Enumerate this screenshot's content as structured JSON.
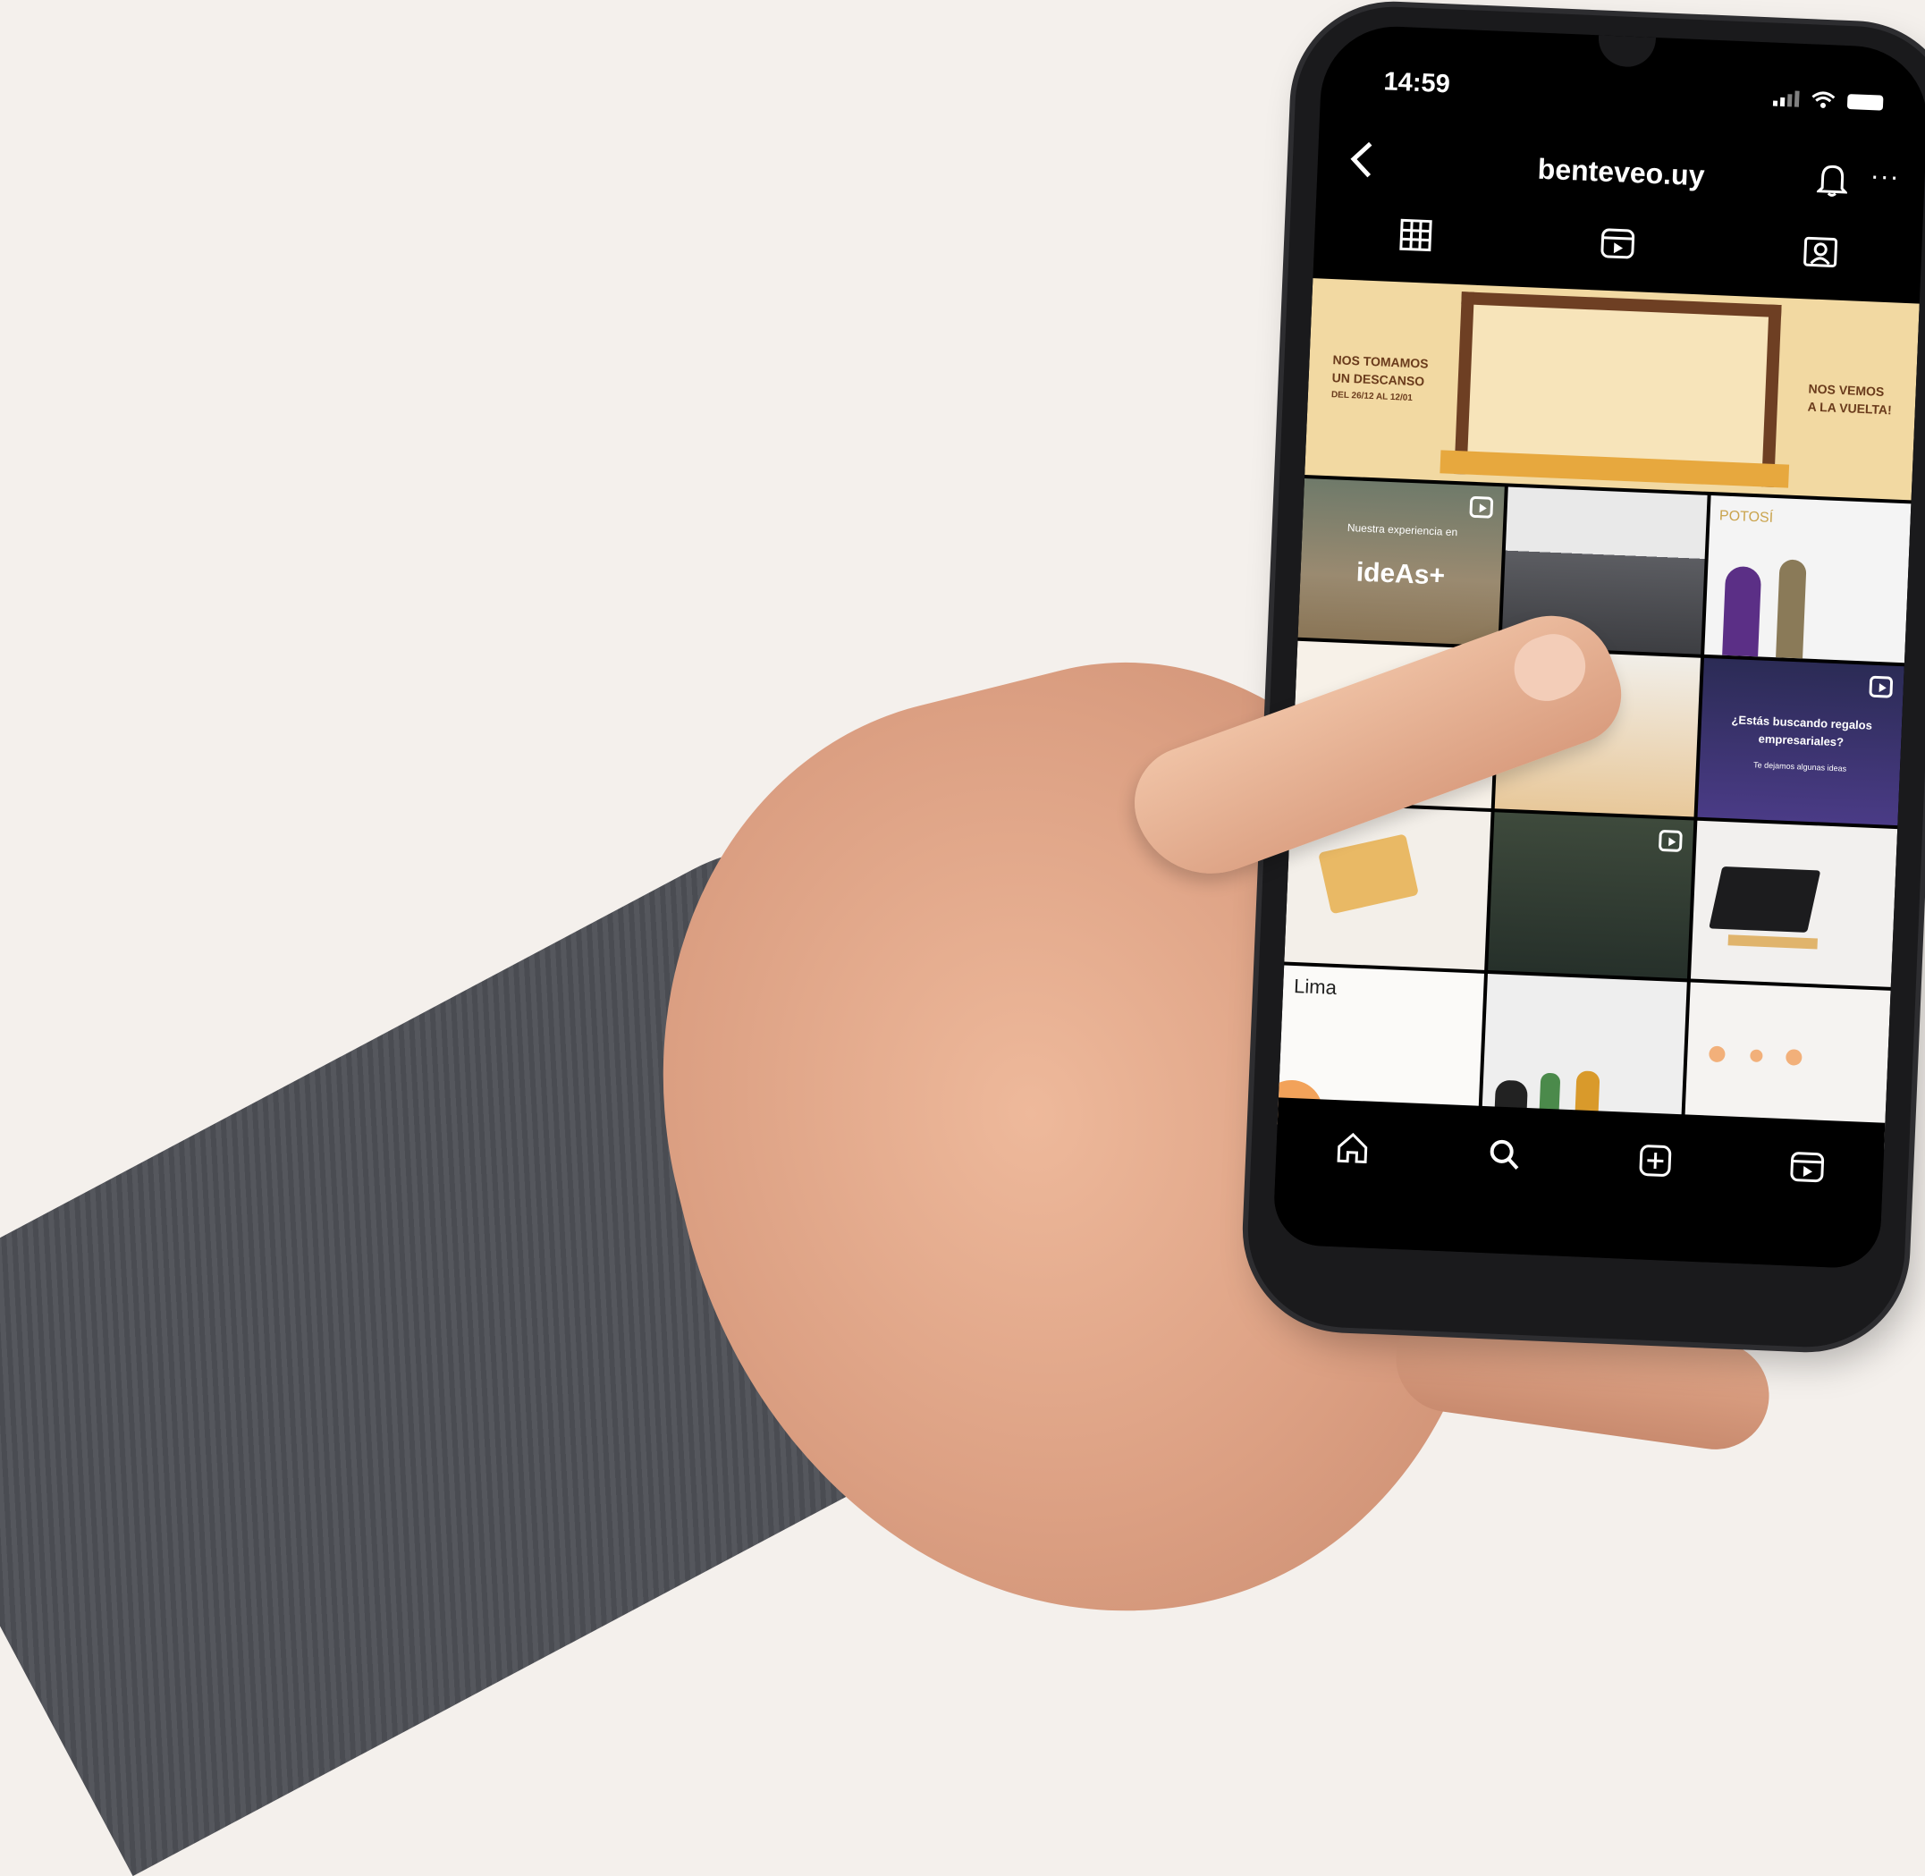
{
  "status_bar": {
    "time": "14:59"
  },
  "header": {
    "back_icon": "chevron-left-icon",
    "username": "benteveo.uy",
    "bell_icon": "bell-icon",
    "more_label": "···"
  },
  "tabs": [
    "grid-icon",
    "reels-icon",
    "tagged-icon"
  ],
  "posts": {
    "banner": {
      "left_line1": "NOS TOMAMOS",
      "left_line2": "UN DESCANSO",
      "left_line3": "DEL 26/12 AL 12/01",
      "right_line1": "NOS VEMOS",
      "right_line2": "A LA VUELTA!"
    },
    "ideas": {
      "caption": "Nuestra experiencia en",
      "logo": "ideAs+"
    },
    "potosi": {
      "title": "POTOSÍ"
    },
    "purple": {
      "line1": "¿Estás buscando regalos",
      "line2": "empresariales?",
      "line3": "Te dejamos algunas ideas"
    },
    "lima": {
      "title": "Lima"
    }
  },
  "bottom_nav": [
    "home-icon",
    "search-icon",
    "new-post-icon",
    "reels-icon"
  ],
  "colors": {
    "background": "#f4f0ec",
    "screen": "#000000",
    "banner": "#f2d9a2",
    "brand_brown": "#6a3b1c"
  }
}
